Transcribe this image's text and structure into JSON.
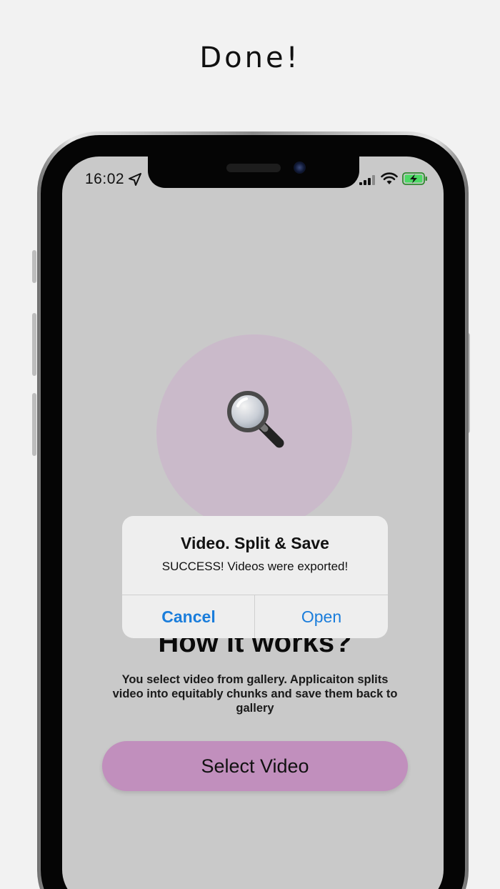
{
  "headline": "Done!",
  "status_bar": {
    "time": "16:02",
    "icons": [
      "location-arrow-icon",
      "cellular-signal-icon",
      "wifi-icon",
      "battery-charging-icon"
    ]
  },
  "feature": {
    "icon": "magnifying-glass-icon",
    "circle_color": "#cabaca"
  },
  "how_it_works": {
    "title": "How it works?",
    "description": "You select video from gallery. Applicaiton splits video into equitably chunks and save them back to gallery"
  },
  "select_button": {
    "label": "Select Video",
    "color": "#c18fbd"
  },
  "alert": {
    "title": "Video. Split & Save",
    "message": "SUCCESS! Videos were exported!",
    "cancel_label": "Cancel",
    "open_label": "Open",
    "button_color": "#1a7ddb"
  },
  "colors": {
    "page_background": "#f2f2f2",
    "screen_background": "#c9c9c9",
    "battery_charging": "#4cd964"
  }
}
